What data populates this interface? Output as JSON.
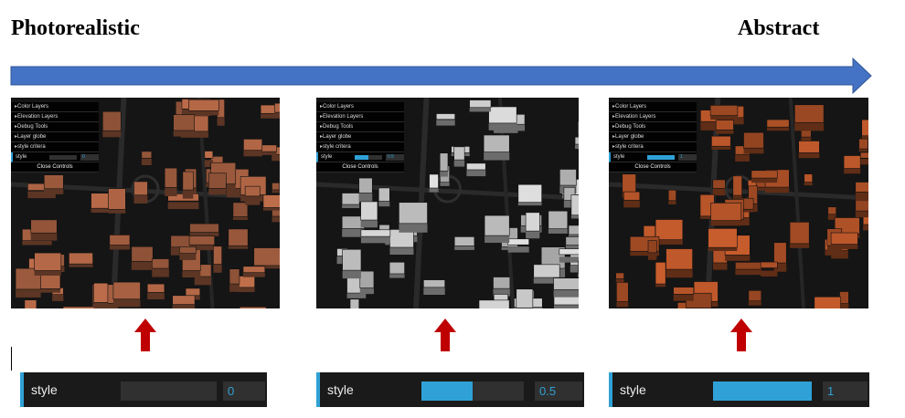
{
  "header": {
    "left_label": "Photorealistic",
    "right_label": "Abstract"
  },
  "colors": {
    "scale_arrow": "#4472c4",
    "pointer_arrow": "#c00000",
    "slider_accent": "#2fa1d6",
    "gui_background": "#1a1a1a"
  },
  "panels": [
    {
      "id": "photorealistic",
      "building_tint": "#b86a48",
      "gui": {
        "folders": [
          "Color Layers",
          "Elevation Layers",
          "Debug Tools",
          "Layer globe",
          "style critera"
        ],
        "style_label": "style",
        "style_value": "0",
        "style_fraction": 0,
        "close_label": "Close Controls"
      }
    },
    {
      "id": "mixed",
      "building_tint": "#d7d7d7",
      "gui": {
        "folders": [
          "Color Layers",
          "Elevation Layers",
          "Debug Tools",
          "Layer globe",
          "style critera"
        ],
        "style_label": "style",
        "style_value": "0.5",
        "style_fraction": 0.5,
        "close_label": "Close Controls"
      }
    },
    {
      "id": "abstract",
      "building_tint": "#c0592b",
      "gui": {
        "folders": [
          "Color Layers",
          "Elevation Layers",
          "Debug Tools",
          "Layer globe",
          "style critera"
        ],
        "style_label": "style",
        "style_value": "1",
        "style_fraction": 1,
        "close_label": "Close Controls"
      }
    }
  ],
  "controls": [
    {
      "label": "style",
      "value": "0",
      "fraction": 0
    },
    {
      "label": "style",
      "value": "0.5",
      "fraction": 0.5
    },
    {
      "label": "style",
      "value": "1",
      "fraction": 1
    }
  ]
}
